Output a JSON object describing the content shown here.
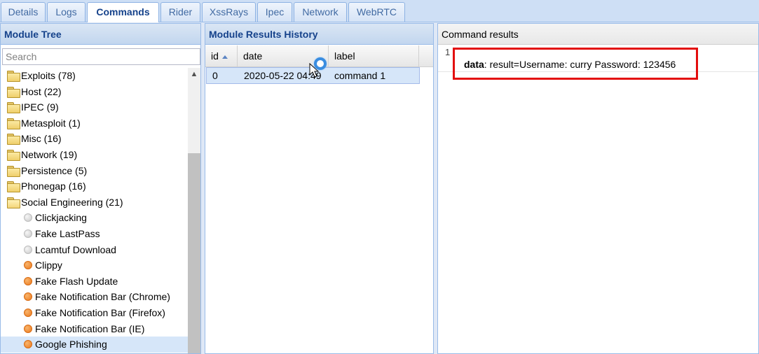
{
  "tabs": [
    {
      "label": "Details",
      "active": false
    },
    {
      "label": "Logs",
      "active": false
    },
    {
      "label": "Commands",
      "active": true
    },
    {
      "label": "Rider",
      "active": false
    },
    {
      "label": "XssRays",
      "active": false
    },
    {
      "label": "Ipec",
      "active": false
    },
    {
      "label": "Network",
      "active": false
    },
    {
      "label": "WebRTC",
      "active": false
    }
  ],
  "module_tree": {
    "title": "Module Tree",
    "search_placeholder": "Search",
    "items": [
      {
        "type": "folder",
        "label": "Exploits (78)"
      },
      {
        "type": "folder",
        "label": "Host (22)"
      },
      {
        "type": "folder",
        "label": "IPEC (9)"
      },
      {
        "type": "folder",
        "label": "Metasploit (1)"
      },
      {
        "type": "folder",
        "label": "Misc (16)"
      },
      {
        "type": "folder",
        "label": "Network (19)"
      },
      {
        "type": "folder",
        "label": "Persistence (5)"
      },
      {
        "type": "folder",
        "label": "Phonegap (16)"
      },
      {
        "type": "folder-open",
        "label": "Social Engineering (21)"
      },
      {
        "type": "module",
        "status": "gray",
        "label": "Clickjacking"
      },
      {
        "type": "module",
        "status": "gray",
        "label": "Fake LastPass"
      },
      {
        "type": "module",
        "status": "gray",
        "label": "Lcamtuf Download"
      },
      {
        "type": "module",
        "status": "orange",
        "label": "Clippy"
      },
      {
        "type": "module",
        "status": "orange",
        "label": "Fake Flash Update"
      },
      {
        "type": "module",
        "status": "orange",
        "label": "Fake Notification Bar (Chrome)"
      },
      {
        "type": "module",
        "status": "orange",
        "label": "Fake Notification Bar (Firefox)"
      },
      {
        "type": "module",
        "status": "orange",
        "label": "Fake Notification Bar (IE)"
      },
      {
        "type": "module",
        "status": "orange",
        "label": "Google Phishing",
        "selected": true
      }
    ]
  },
  "history": {
    "title": "Module Results History",
    "columns": [
      "id",
      "date",
      "label"
    ],
    "sort_column": "id",
    "rows": [
      {
        "id": "0",
        "date": "2020-05-22 04:49",
        "label": "command 1"
      }
    ]
  },
  "results": {
    "title": "Command results",
    "row_number": "1",
    "key": "data",
    "value": ": result=Username: curry Password: 123456"
  },
  "colors": {
    "accent": "#15428b",
    "highlight_border": "#e30d0d",
    "status_gray": "#c8c8c8",
    "status_orange": "#ec7a1d"
  }
}
